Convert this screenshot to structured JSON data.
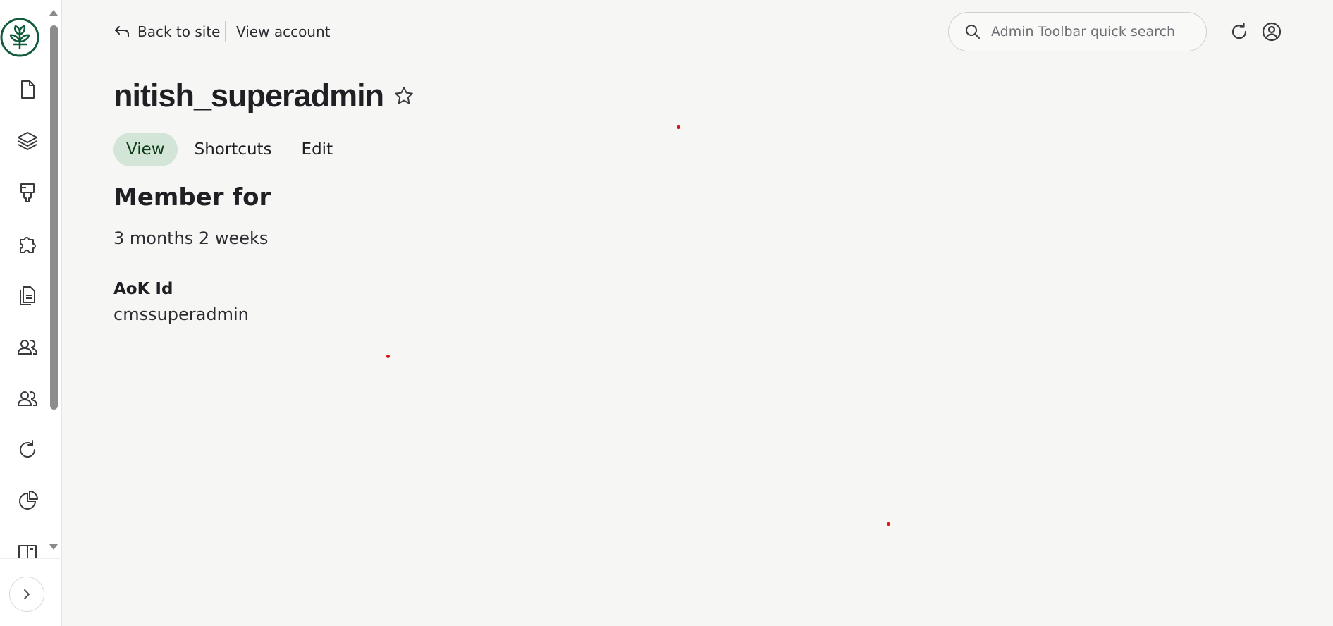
{
  "sidebar": {
    "logo": "plant-logo-icon",
    "items": [
      {
        "icon": "document-icon"
      },
      {
        "icon": "layers-icon"
      },
      {
        "icon": "paint-brush-icon"
      },
      {
        "icon": "puzzle-icon"
      },
      {
        "icon": "reports-icon"
      },
      {
        "icon": "people-icon"
      },
      {
        "icon": "people-icon"
      },
      {
        "icon": "refresh-icon"
      },
      {
        "icon": "pie-chart-icon"
      },
      {
        "icon": "book-icon"
      }
    ],
    "expand_icon": "chevron-right-icon"
  },
  "topbar": {
    "back_label": "Back to site",
    "view_account_label": "View account",
    "search_placeholder": "Admin Toolbar quick search"
  },
  "page": {
    "title": "nitish_superadmin",
    "tabs": [
      {
        "label": "View",
        "active": true
      },
      {
        "label": "Shortcuts",
        "active": false
      },
      {
        "label": "Edit",
        "active": false
      }
    ],
    "member_heading": "Member for",
    "member_value": "3 months 2 weeks",
    "aok_label": "AoK Id",
    "aok_value": "cmssuperadmin"
  },
  "colors": {
    "accent": "#0f5b3a",
    "active_tab_bg": "#d3e5d6",
    "background": "#f6f7f5"
  }
}
